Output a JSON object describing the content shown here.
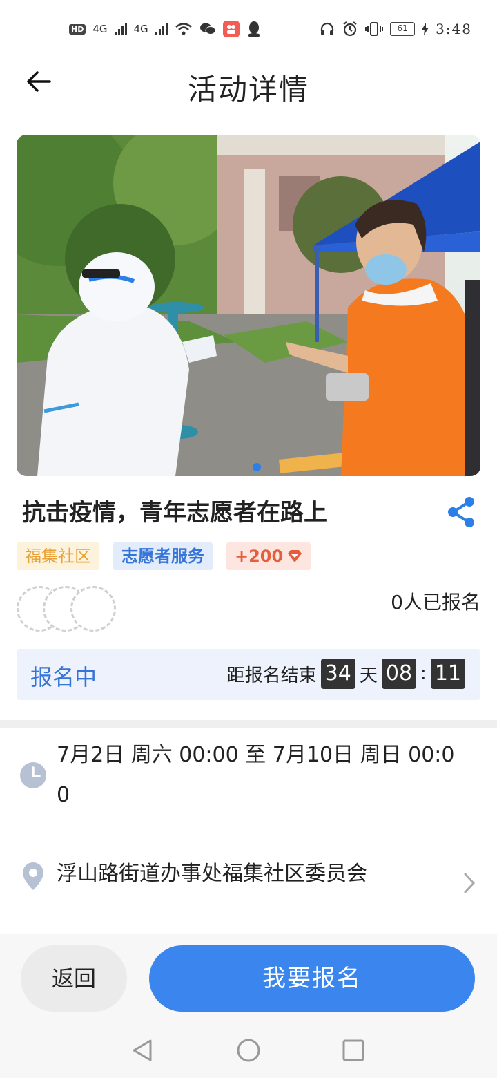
{
  "status_bar": {
    "hd_label": "HD",
    "network_1": "4G",
    "network_2": "4G",
    "battery": "61",
    "time": "3:48"
  },
  "header": {
    "title": "活动详情"
  },
  "activity": {
    "title": "抗击疫情，青年志愿者在路上",
    "banner_slide_index": 1,
    "banner_slide_count": 1,
    "tags": {
      "community": "福集社区",
      "category": "志愿者服务",
      "points": "+200"
    },
    "signup_count_text": "0人已报名",
    "status_label": "报名中",
    "countdown": {
      "prefix": "距报名结束",
      "days": "34",
      "days_unit": "天",
      "hours": "08",
      "separator": ":",
      "minutes": "11"
    },
    "time_range_line1": "7月2日 周六 00:00 至 7月10日 周日 00:0",
    "time_range_line2": "0",
    "location": "浮山路街道办事处福集社区委员会"
  },
  "bottom_bar": {
    "back_label": "返回",
    "signup_label": "我要报名"
  },
  "colors": {
    "accent": "#3a86ee",
    "tag_orange": "#e8a23a",
    "tag_blue": "#3574d9",
    "tag_red": "#e55d3c"
  }
}
